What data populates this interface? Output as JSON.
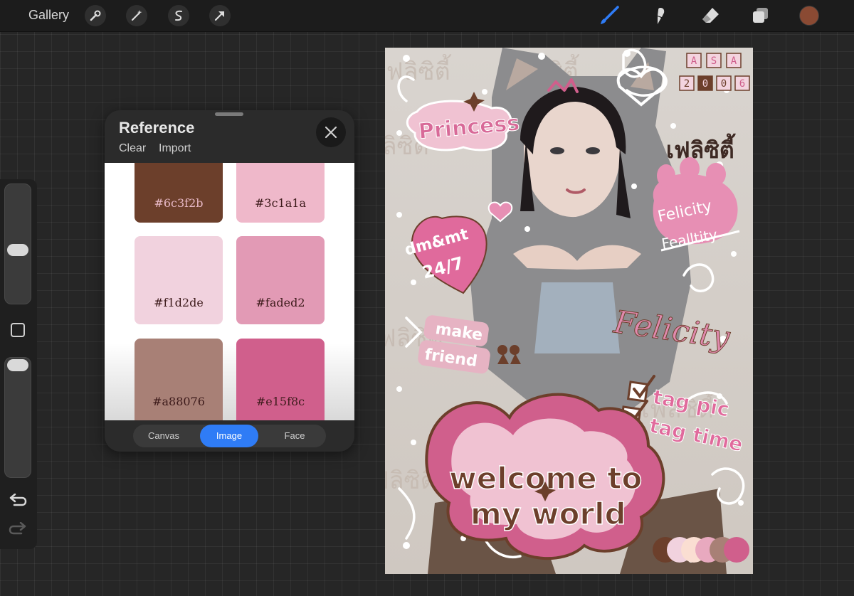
{
  "toolbar": {
    "gallery_label": "Gallery",
    "left_tools": [
      "wrench-icon",
      "magic-wand-icon",
      "selection-icon",
      "transform-arrow-icon"
    ],
    "right_tools": [
      "brush-icon",
      "smudge-icon",
      "eraser-icon",
      "layers-icon"
    ],
    "active_tool": "brush-icon",
    "current_color": "#8a4a33"
  },
  "reference": {
    "title": "Reference",
    "clear_label": "Clear",
    "import_label": "Import",
    "swatches": [
      {
        "label": "#6c3f2b",
        "color": "#6c3f2b",
        "text_color": "#e8b9c6"
      },
      {
        "label": "#3c1a1a",
        "color": "#efb8ca",
        "text_color": "#3c1a1a"
      },
      {
        "label": "#f1d2de",
        "color": "#f1d2de",
        "text_color": "#3c1a1a"
      },
      {
        "label": "#faded2",
        "color": "#e29ab5",
        "text_color": "#3c1a1a"
      },
      {
        "label": "#a88076",
        "color": "#a88076",
        "text_color": "#3c1a1a"
      },
      {
        "label": "#e15f8c",
        "color": "#d05f8c",
        "text_color": "#3c1a1a"
      }
    ],
    "tabs": [
      {
        "label": "Canvas",
        "active": false
      },
      {
        "label": "Image",
        "active": true
      },
      {
        "label": "Face",
        "active": false
      }
    ],
    "accent": "#2f7cf6"
  },
  "artwork": {
    "princess": "Princess",
    "thai_text": "เฟลิซิตี้",
    "felicity_small": "Felicity",
    "felicity_strike": "Fealltity",
    "felicity_script": "Felicity",
    "dm_line1": "dm&mt",
    "dm_line2": "24/7",
    "make": "make",
    "friend": "friend",
    "tag1": "tag pic",
    "tag2": "tag time",
    "welcome_line1": "welcome to",
    "welcome_line2": "my world",
    "asa_letters": [
      "A",
      "S",
      "A"
    ],
    "year_digits": [
      "2",
      "0",
      "0",
      "6"
    ],
    "palette": [
      "#6c3f2b",
      "#f1d2de",
      "#faded2",
      "#e8a9bf",
      "#a88076",
      "#d05f8c"
    ],
    "pink": "#e07aa0",
    "brown": "#6c3f2b"
  }
}
